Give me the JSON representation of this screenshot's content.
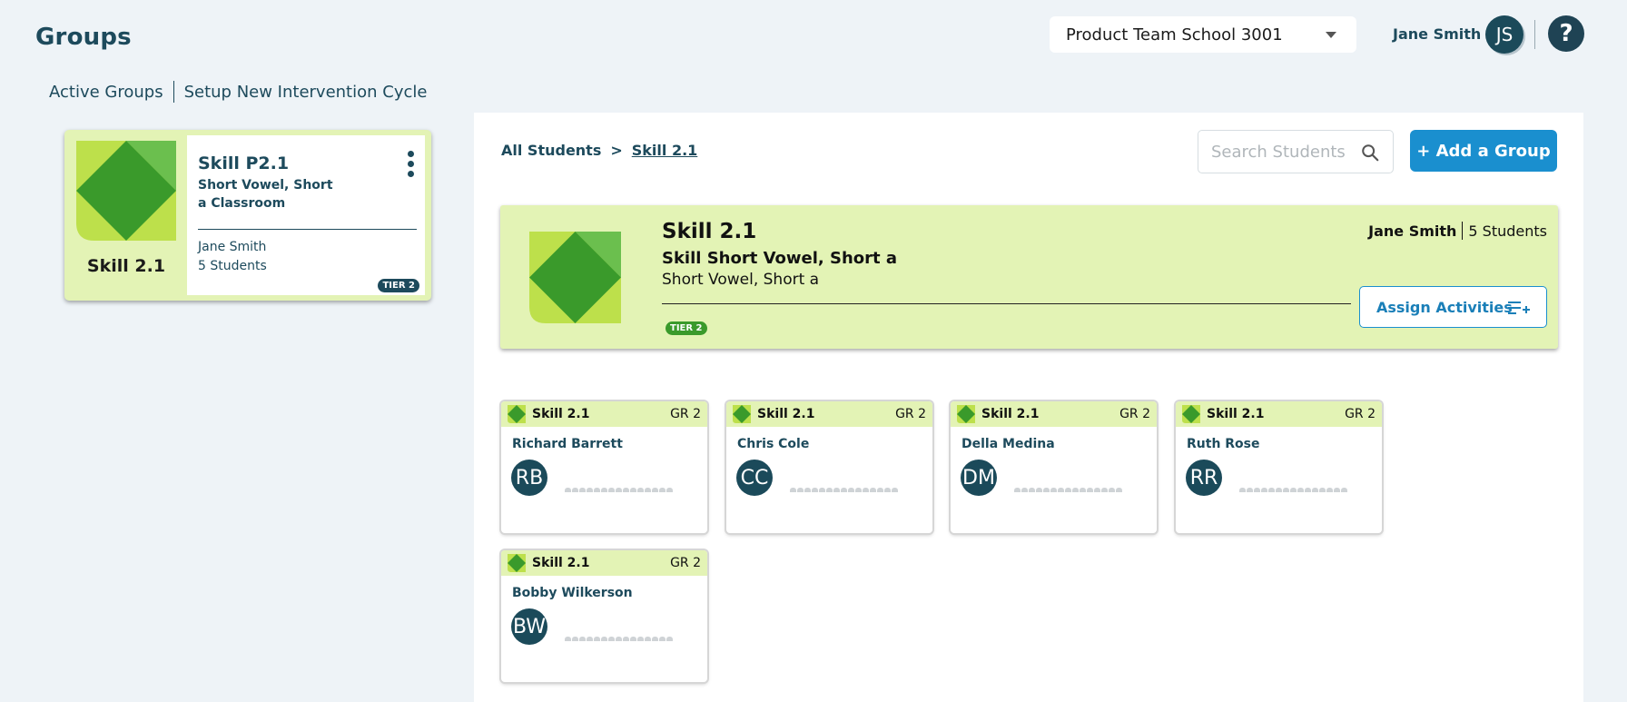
{
  "header": {
    "title": "Groups",
    "school": "Product Team School 3001",
    "user_name": "Jane Smith",
    "user_initials": "JS",
    "help": "?"
  },
  "sub_nav": {
    "active_groups": "Active Groups",
    "setup_cycle": "Setup New Intervention Cycle"
  },
  "group_card": {
    "thumb_label": "Skill 2.1",
    "name": "Skill P2.1",
    "description": "Short Vowel, Short a Classroom",
    "teacher": "Jane Smith",
    "count": "5 Students",
    "tier": "TIER 2"
  },
  "breadcrumb": {
    "root": "All Students",
    "separator": ">",
    "current": "Skill 2.1"
  },
  "search": {
    "placeholder": "Search Students"
  },
  "add_group": "+ Add a Group",
  "group_header": {
    "title": "Skill 2.1",
    "subtitle": "Skill Short Vowel, Short a",
    "subtitle2": "Short Vowel, Short a",
    "teacher": "Jane Smith",
    "count": "5 Students",
    "tier": "TIER 2",
    "assign_label": "Assign Activities"
  },
  "students": [
    {
      "skill": "Skill 2.1",
      "grade": "GR 2",
      "name": "Richard Barrett",
      "initials": "RB"
    },
    {
      "skill": "Skill 2.1",
      "grade": "GR 2",
      "name": "Chris Cole",
      "initials": "CC"
    },
    {
      "skill": "Skill 2.1",
      "grade": "GR 2",
      "name": "Della Medina",
      "initials": "DM"
    },
    {
      "skill": "Skill 2.1",
      "grade": "GR 2",
      "name": "Ruth Rose",
      "initials": "RR"
    },
    {
      "skill": "Skill 2.1",
      "grade": "GR 2",
      "name": "Bobby Wilkerson",
      "initials": "BW"
    }
  ],
  "colors": {
    "brand_dark": "#1d4a5c",
    "accent_blue": "#1a8fcf",
    "skill_green": "#3a9a2b",
    "skill_light": "#e3f3b5"
  }
}
